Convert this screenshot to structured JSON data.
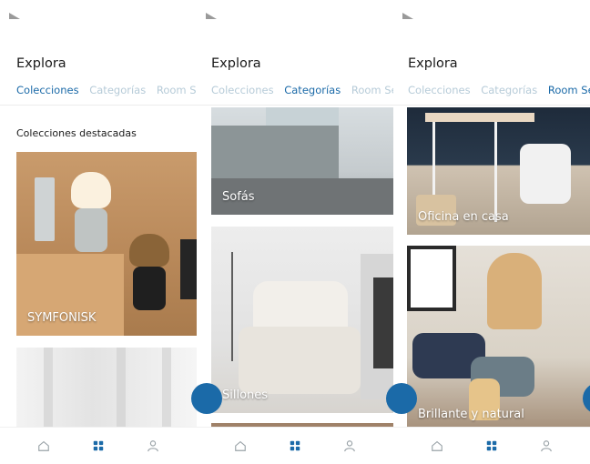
{
  "screens": [
    {
      "title": "Explora",
      "tabs": [
        "Colecciones",
        "Categorías",
        "Room Sets"
      ],
      "active_tab": 0,
      "section_label": "Colecciones destacadas",
      "cards": [
        {
          "label": "SYMFONISK"
        },
        {
          "label": ""
        }
      ]
    },
    {
      "title": "Explora",
      "tabs": [
        "Colecciones",
        "Categorías",
        "Room Sets"
      ],
      "active_tab": 1,
      "cards": [
        {
          "label": "Sofás"
        },
        {
          "label": "Sillones"
        }
      ]
    },
    {
      "title": "Explora",
      "tabs": [
        "Colecciones",
        "Categorías",
        "Room Set"
      ],
      "active_tab": 2,
      "cards": [
        {
          "label": "Oficina en casa"
        },
        {
          "label": "Brillante y natural"
        }
      ]
    }
  ],
  "bottom_nav": {
    "items": [
      {
        "icon": "home-icon"
      },
      {
        "icon": "grid-icon"
      },
      {
        "icon": "profile-icon"
      }
    ],
    "active_index": 1
  },
  "colors": {
    "accent": "#1b6aa8",
    "tab_inactive": "#b6cbd8",
    "text": "#1a1a1a"
  }
}
